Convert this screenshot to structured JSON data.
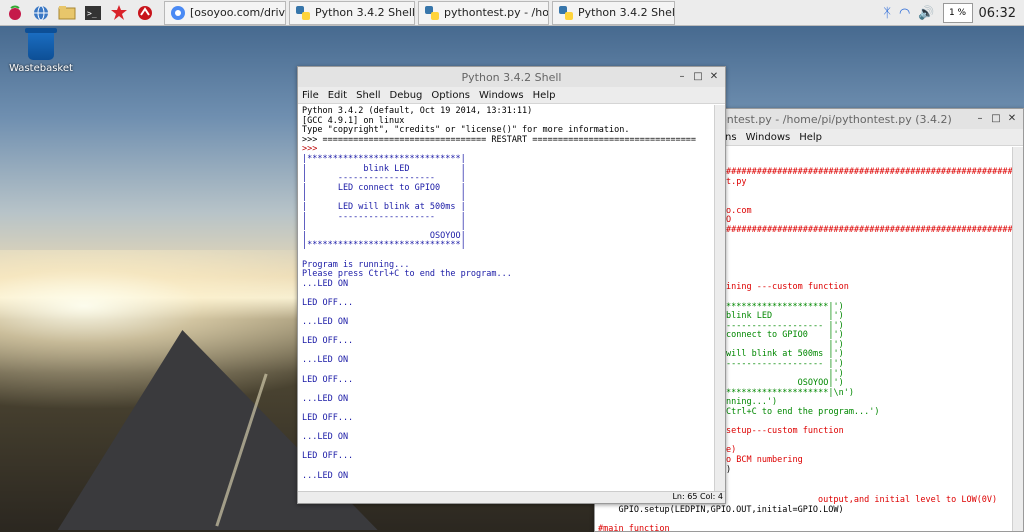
{
  "taskbar": {
    "tasks": [
      {
        "label": "[osoyoo.com/driver/...",
        "icon": "chromium-icon"
      },
      {
        "label": "Python 3.4.2 Shell",
        "icon": "python-icon"
      },
      {
        "label": "pythontest.py - /hom...",
        "icon": "python-icon"
      },
      {
        "label": "Python 3.4.2 Shell",
        "icon": "python-icon"
      }
    ],
    "cpu": "1 %",
    "clock": "06:32"
  },
  "desktop": {
    "wastebasket_label": "Wastebasket"
  },
  "shell": {
    "title": "Python 3.4.2 Shell",
    "menu": [
      "File",
      "Edit",
      "Shell",
      "Debug",
      "Options",
      "Windows",
      "Help"
    ],
    "status": "Ln: 65  Col: 4",
    "lines": [
      {
        "t": "Python 3.4.2 (default, Oct 19 2014, 13:31:11)",
        "c": "#000"
      },
      {
        "t": "[GCC 4.9.1] on linux",
        "c": "#000"
      },
      {
        "t": "Type \"copyright\", \"credits\" or \"license()\" for more information.",
        "c": "#000"
      },
      {
        "t": ">>> ================================ RESTART ================================",
        "c": "#000"
      },
      {
        "t": ">>> ",
        "c": "#b00"
      },
      {
        "t": "|******************************|",
        "c": "#1a1aa6"
      },
      {
        "t": "|           blink LED          |",
        "c": "#1a1aa6"
      },
      {
        "t": "|      -------------------     |",
        "c": "#1a1aa6"
      },
      {
        "t": "|      LED connect to GPIO0    |",
        "c": "#1a1aa6"
      },
      {
        "t": "|                              |",
        "c": "#1a1aa6"
      },
      {
        "t": "|      LED will blink at 500ms |",
        "c": "#1a1aa6"
      },
      {
        "t": "|      -------------------     |",
        "c": "#1a1aa6"
      },
      {
        "t": "|                              |",
        "c": "#1a1aa6"
      },
      {
        "t": "|                        OSOYOO|",
        "c": "#1a1aa6"
      },
      {
        "t": "|******************************|",
        "c": "#1a1aa6"
      },
      {
        "t": "",
        "c": "#000"
      },
      {
        "t": "Program is running...",
        "c": "#1a1aa6"
      },
      {
        "t": "Please press Ctrl+C to end the program...",
        "c": "#1a1aa6"
      },
      {
        "t": "...LED ON",
        "c": "#1a1aa6"
      },
      {
        "t": "",
        "c": "#000"
      },
      {
        "t": "LED OFF...",
        "c": "#1a1aa6"
      },
      {
        "t": "",
        "c": "#000"
      },
      {
        "t": "...LED ON",
        "c": "#1a1aa6"
      },
      {
        "t": "",
        "c": "#000"
      },
      {
        "t": "LED OFF...",
        "c": "#1a1aa6"
      },
      {
        "t": "",
        "c": "#000"
      },
      {
        "t": "...LED ON",
        "c": "#1a1aa6"
      },
      {
        "t": "",
        "c": "#000"
      },
      {
        "t": "LED OFF...",
        "c": "#1a1aa6"
      },
      {
        "t": "",
        "c": "#000"
      },
      {
        "t": "...LED ON",
        "c": "#1a1aa6"
      },
      {
        "t": "",
        "c": "#000"
      },
      {
        "t": "LED OFF...",
        "c": "#1a1aa6"
      },
      {
        "t": "",
        "c": "#000"
      },
      {
        "t": "...LED ON",
        "c": "#1a1aa6"
      },
      {
        "t": "",
        "c": "#000"
      },
      {
        "t": "LED OFF...",
        "c": "#1a1aa6"
      },
      {
        "t": "",
        "c": "#000"
      },
      {
        "t": "...LED ON",
        "c": "#1a1aa6"
      }
    ]
  },
  "editor": {
    "title": "ontest.py - /home/pi/pythontest.py (3.4.2)",
    "menu": [
      "ns",
      "Windows",
      "Help"
    ],
    "lines": [
      {
        "t": "",
        "c": "#000"
      },
      {
        "t": "",
        "c": "#000"
      },
      {
        "t": "##################################################################",
        "c": "#d00"
      },
      {
        "t": "t.py",
        "c": "#d00"
      },
      {
        "t": "",
        "c": "#000"
      },
      {
        "t": "",
        "c": "#000"
      },
      {
        "t": "o.com",
        "c": "#d00"
      },
      {
        "t": "O",
        "c": "#d00"
      },
      {
        "t": "##################################################################",
        "c": "#d00"
      },
      {
        "t": "",
        "c": "#000"
      },
      {
        "t": "",
        "c": "#000"
      },
      {
        "t": "",
        "c": "#000"
      },
      {
        "t": "",
        "c": "#000"
      },
      {
        "t": "",
        "c": "#000"
      },
      {
        "t": "ining ---custom function",
        "c": "#d00"
      },
      {
        "t": "",
        "c": "#000"
      },
      {
        "t": "********************|')",
        "c": "#080"
      },
      {
        "t": "blink LED           |')",
        "c": "#080"
      },
      {
        "t": "------------------- |')",
        "c": "#080"
      },
      {
        "t": "connect to GPIO0    |')",
        "c": "#080"
      },
      {
        "t": "                    |')",
        "c": "#080"
      },
      {
        "t": "will blink at 500ms |')",
        "c": "#080"
      },
      {
        "t": "------------------- |')",
        "c": "#080"
      },
      {
        "t": "                    |')",
        "c": "#080"
      },
      {
        "t": "              OSOYOO|')",
        "c": "#080"
      },
      {
        "t": "********************|\\n')",
        "c": "#080"
      },
      {
        "t": "nning...')",
        "c": "#080"
      },
      {
        "t": "Ctrl+C to end the program...')",
        "c": "#080"
      },
      {
        "t": "",
        "c": "#000"
      },
      {
        "t": "setup---custom function",
        "c": "#d00"
      },
      {
        "t": "",
        "c": "#000"
      },
      {
        "t": "e)",
        "c": "#d00"
      },
      {
        "t": "o BCM numbering",
        "c": "#d00"
      },
      {
        "t": ")",
        "c": "#000"
      }
    ],
    "bottom_lines": [
      {
        "t": "                                           output,and initial level to LOW(0V)",
        "c": "#d00"
      },
      {
        "t": "    GPIO.setup(LEDPIN,GPIO.OUT,initial=GPIO.LOW)",
        "c": "#000"
      },
      {
        "t": "",
        "c": "#000"
      },
      {
        "t": "#main function",
        "c": "#d00"
      }
    ]
  }
}
